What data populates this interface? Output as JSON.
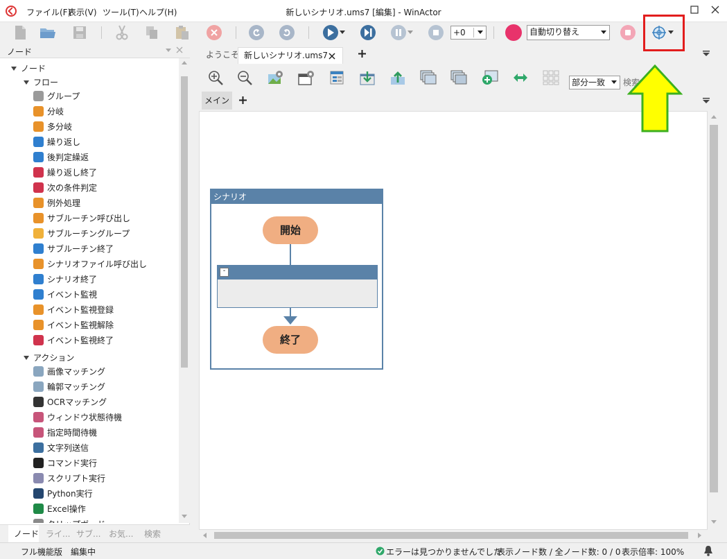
{
  "window": {
    "title": "新しいシナリオ.ums7 [編集] - WinActor",
    "menu": [
      "ファイル(F)",
      "表示(V)",
      "ツール(T)",
      "ヘルプ(H)"
    ]
  },
  "toolbar": {
    "speed_value": "+0",
    "record_mode": "自動切り替え"
  },
  "left_panel": {
    "title": "ノード",
    "root_label": "ノード",
    "flow_label": "フロー",
    "flow_items": [
      {
        "label": "グループ",
        "icon": "group-icon"
      },
      {
        "label": "分岐",
        "icon": "branch-icon"
      },
      {
        "label": "多分岐",
        "icon": "multi-branch-icon"
      },
      {
        "label": "繰り返し",
        "icon": "loop-icon"
      },
      {
        "label": "後判定繰返",
        "icon": "post-loop-icon"
      },
      {
        "label": "繰り返し終了",
        "icon": "loop-end-icon"
      },
      {
        "label": "次の条件判定",
        "icon": "next-condition-icon"
      },
      {
        "label": "例外処理",
        "icon": "exception-icon"
      },
      {
        "label": "サブルーチン呼び出し",
        "icon": "subroutine-call-icon"
      },
      {
        "label": "サブルーチングループ",
        "icon": "subroutine-group-icon"
      },
      {
        "label": "サブルーチン終了",
        "icon": "subroutine-end-icon"
      },
      {
        "label": "シナリオファイル呼び出し",
        "icon": "scenario-call-icon"
      },
      {
        "label": "シナリオ終了",
        "icon": "scenario-end-icon"
      },
      {
        "label": "イベント監視",
        "icon": "event-watch-icon"
      },
      {
        "label": "イベント監視登録",
        "icon": "event-register-icon"
      },
      {
        "label": "イベント監視解除",
        "icon": "event-unregister-icon"
      },
      {
        "label": "イベント監視終了",
        "icon": "event-end-icon"
      }
    ],
    "action_label": "アクション",
    "action_items": [
      {
        "label": "画像マッチング",
        "icon": "image-matching-icon"
      },
      {
        "label": "輪郭マッチング",
        "icon": "contour-matching-icon"
      },
      {
        "label": "OCRマッチング",
        "icon": "ocr-icon"
      },
      {
        "label": "ウィンドウ状態待機",
        "icon": "window-wait-icon"
      },
      {
        "label": "指定時間待機",
        "icon": "clock-icon"
      },
      {
        "label": "文字列送信",
        "icon": "text-send-icon"
      },
      {
        "label": "コマンド実行",
        "icon": "command-icon"
      },
      {
        "label": "スクリプト実行",
        "icon": "script-icon"
      },
      {
        "label": "Python実行",
        "icon": "python-icon"
      },
      {
        "label": "Excel操作",
        "icon": "excel-icon"
      },
      {
        "label": "クリップボード",
        "icon": "clipboard-icon"
      }
    ],
    "bottom_tabs": [
      "ノード",
      "ライ...",
      "サブ...",
      "お気...",
      "検索"
    ]
  },
  "editor": {
    "tabs": [
      "ようこそ",
      "新しいシナリオ.ums7"
    ],
    "match_mode": "部分一致",
    "search_placeholder": "検索文",
    "sub_tab": "メイン",
    "scenario_title": "シナリオ",
    "start_label": "開始",
    "end_label": "終了",
    "group_toggle": "-"
  },
  "status": {
    "mode": "フル機能版　編集中",
    "errors": "エラーは見つかりませんでした",
    "node_count": "表示ノード数 / 全ノード数: 0 / 0",
    "zoom": "表示倍率: 100%"
  },
  "colors": {
    "accent": "#5a82a8",
    "terminal": "#f0ae82",
    "highlight": "#e21d1d",
    "arrow": "#ffff00",
    "record": "#e8336b"
  }
}
